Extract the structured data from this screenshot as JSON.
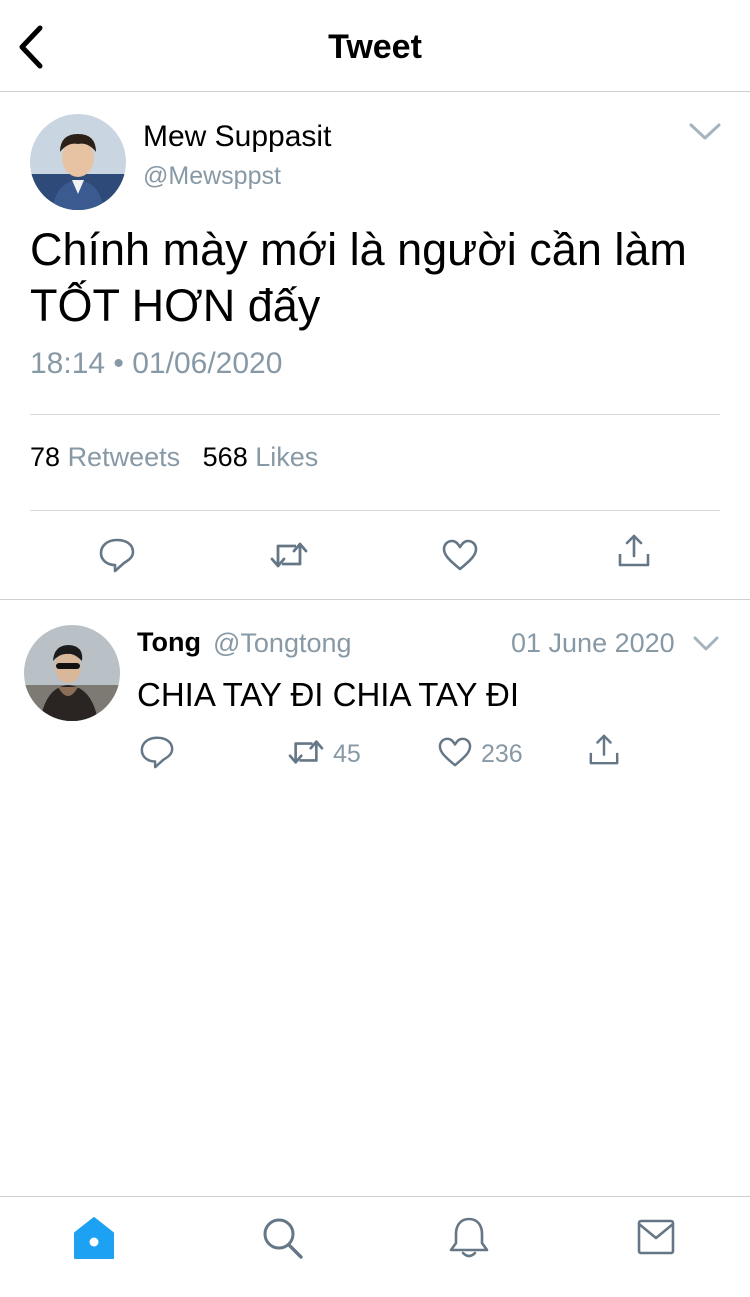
{
  "header": {
    "title": "Tweet"
  },
  "tweet": {
    "author_name": "Mew Suppasit",
    "author_handle": "@Mewsppst",
    "text": "Chính mày mới là người cần làm TỐT HƠN đấy",
    "timestamp": "18:14 • 01/06/2020",
    "retweets_count": "78",
    "retweets_label": "Retweets",
    "likes_count": "568",
    "likes_label": "Likes"
  },
  "reply": {
    "author_name": "Tong",
    "author_handle": "@Tongtong",
    "date": "01 June 2020",
    "text": "CHIA TAY ĐI CHIA TAY ĐI",
    "retweets": "45",
    "likes": "236"
  },
  "tabbar": {
    "tabs": [
      "home-icon",
      "search-icon",
      "bell-icon",
      "mail-icon"
    ],
    "active": "home-icon"
  },
  "colors": {
    "accent": "#1da1f2",
    "muted": "#8899a6",
    "icon": "#657786"
  }
}
